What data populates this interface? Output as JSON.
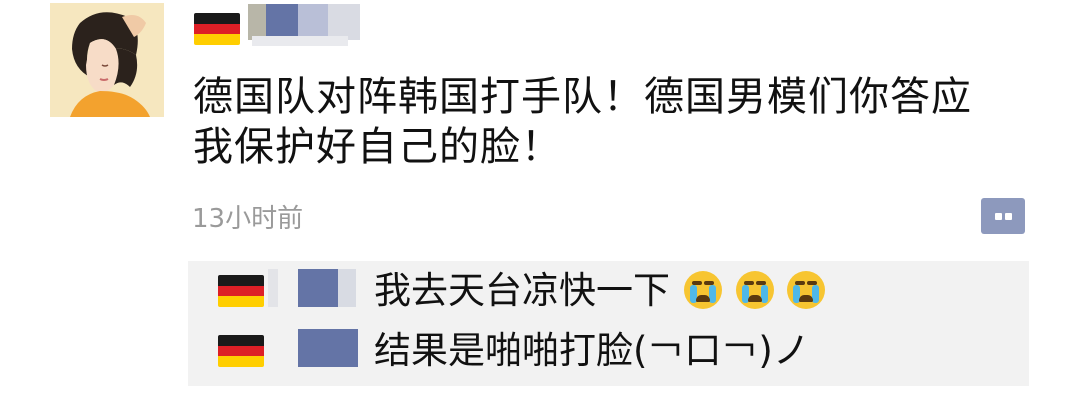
{
  "comment": {
    "text_line1": "德国队对阵韩国打手队！德国男模们你答应",
    "text_line2": "我保护好自己的脸！",
    "timestamp": "13小时前"
  },
  "replies": [
    {
      "text": "我去天台凉快一下",
      "emoji_count": 3
    },
    {
      "text": "结果是啪啪打脸(￢口￢)ノ",
      "emoji_count": 0
    }
  ],
  "icons": {
    "flag": "germany-flag-icon",
    "comment": "comment-bubble-icon",
    "emoji": "crying-face-icon"
  },
  "colors": {
    "reply_background": "#f2f2f2",
    "comment_button": "#8d99bd",
    "timestamp": "#9a9a9a"
  }
}
